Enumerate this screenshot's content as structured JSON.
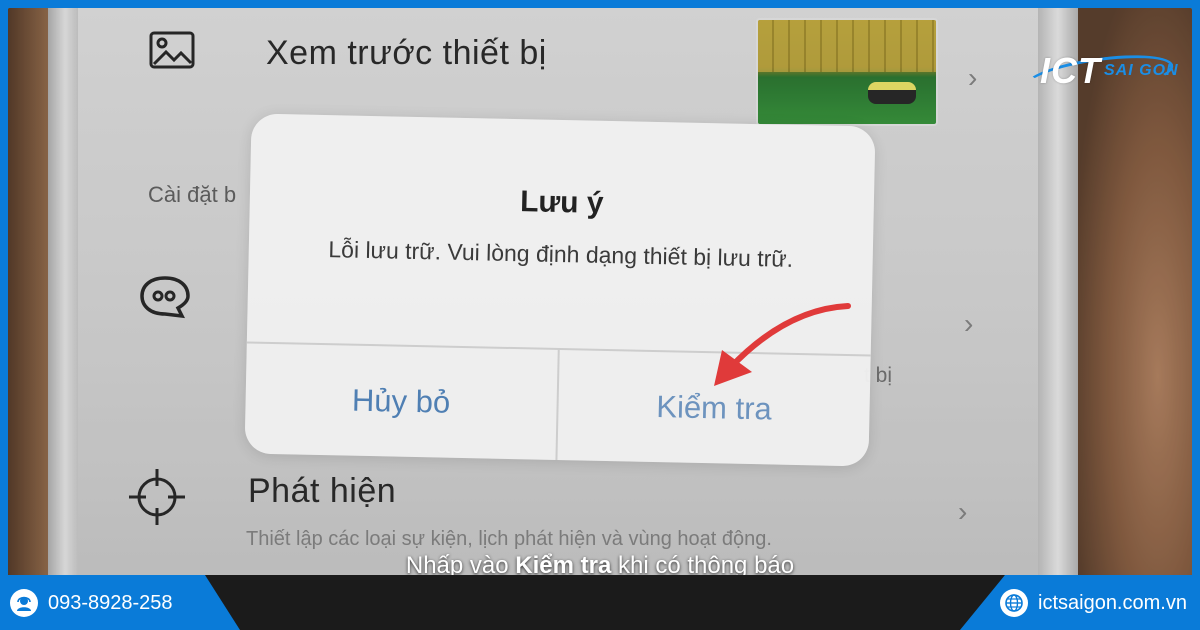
{
  "app": {
    "rows": [
      {
        "title": "Xem trước thiết bị",
        "icon": "image-icon"
      },
      {
        "section_label": "Cài đặt b"
      },
      {
        "icon": "chat-bubble-icon",
        "trailing_text": "t bị"
      },
      {
        "title": "Phát hiện",
        "subtitle": "Thiết lập các loại sự kiện, lịch phát hiện và vùng hoạt động.",
        "icon": "crosshair-icon"
      }
    ]
  },
  "dialog": {
    "title": "Lưu ý",
    "message": "Lỗi lưu trữ. Vui lòng định dạng thiết bị lưu trữ.",
    "cancel_label": "Hủy bỏ",
    "confirm_label": "Kiểm tra"
  },
  "logo": {
    "primary": "ICT",
    "secondary": "SAI GON"
  },
  "caption": {
    "prefix": "Nhấp vào ",
    "bold": "Kiểm tra",
    "suffix": " khi có thông báo"
  },
  "footer": {
    "phone": "093-8928-258",
    "website": "ictsaigon.com.vn"
  },
  "colors": {
    "brand_blue": "#0a7bd8",
    "dialog_button": "#4f7fb3",
    "arrow_red": "#e03a3a"
  }
}
